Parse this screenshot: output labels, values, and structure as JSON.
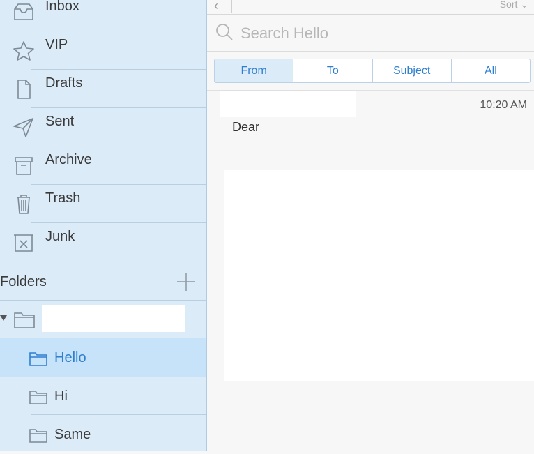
{
  "sidebar": {
    "mailboxes": [
      {
        "label": "Inbox",
        "icon": "inbox-icon"
      },
      {
        "label": "VIP",
        "icon": "star-icon"
      },
      {
        "label": "Drafts",
        "icon": "document-icon"
      },
      {
        "label": "Sent",
        "icon": "paper-plane-icon"
      },
      {
        "label": "Archive",
        "icon": "archive-box-icon"
      },
      {
        "label": "Trash",
        "icon": "trash-icon"
      },
      {
        "label": "Junk",
        "icon": "junk-box-icon"
      }
    ],
    "folders_header": "Folders",
    "folders": [
      {
        "label": "Hello",
        "selected": true
      },
      {
        "label": "Hi",
        "selected": false
      },
      {
        "label": "Same",
        "selected": false
      }
    ]
  },
  "topbar": {
    "back_symbol": "‹",
    "sort_label": "Sort ⌄"
  },
  "search": {
    "placeholder": "Search Hello"
  },
  "scope": {
    "options": [
      "From",
      "To",
      "Subject",
      "All"
    ],
    "active": "From"
  },
  "messages": [
    {
      "time": "10:20 AM",
      "subject": "Dear"
    }
  ],
  "colors": {
    "sidebar_bg": "#dcebf8",
    "accent": "#2f7fd1",
    "selected_bg": "#c6e3f9"
  }
}
